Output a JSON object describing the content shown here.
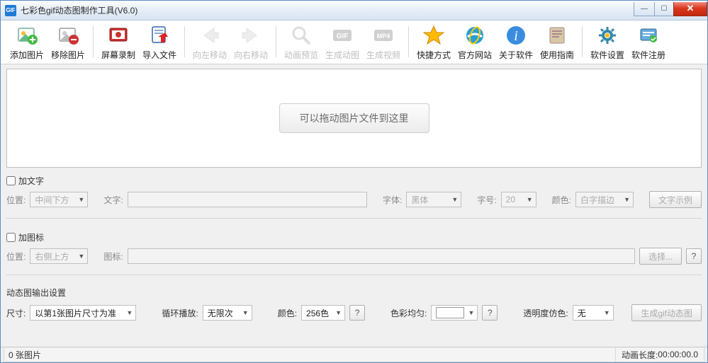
{
  "title": "七彩色gif动态图制作工具(V6.0)",
  "app_icon": "GIF",
  "toolbar": [
    {
      "id": "add-image",
      "label": "添加图片",
      "enabled": true,
      "icon": "add-image"
    },
    {
      "id": "remove-image",
      "label": "移除图片",
      "enabled": true,
      "icon": "remove-image"
    },
    {
      "sep": true
    },
    {
      "id": "screen-record",
      "label": "屏幕录制",
      "enabled": true,
      "icon": "record"
    },
    {
      "id": "import-file",
      "label": "导入文件",
      "enabled": true,
      "icon": "import"
    },
    {
      "sep": true
    },
    {
      "id": "move-left",
      "label": "向左移动",
      "enabled": false,
      "icon": "arrow-left"
    },
    {
      "id": "move-right",
      "label": "向右移动",
      "enabled": false,
      "icon": "arrow-right"
    },
    {
      "sep": true
    },
    {
      "id": "preview",
      "label": "动画预览",
      "enabled": false,
      "icon": "magnify"
    },
    {
      "id": "make-gif",
      "label": "生成动图",
      "enabled": false,
      "icon": "gif"
    },
    {
      "id": "make-video",
      "label": "生成视频",
      "enabled": false,
      "icon": "mp4"
    },
    {
      "sep": true
    },
    {
      "id": "shortcut",
      "label": "快捷方式",
      "enabled": true,
      "icon": "star"
    },
    {
      "id": "website",
      "label": "官方网站",
      "enabled": true,
      "icon": "ie"
    },
    {
      "id": "about",
      "label": "关于软件",
      "enabled": true,
      "icon": "info"
    },
    {
      "id": "guide",
      "label": "使用指南",
      "enabled": true,
      "icon": "book"
    },
    {
      "sep": true
    },
    {
      "id": "settings",
      "label": "软件设置",
      "enabled": true,
      "icon": "gear"
    },
    {
      "id": "register",
      "label": "软件注册",
      "enabled": true,
      "icon": "register"
    }
  ],
  "drop_hint": "可以拖动图片文件到这里",
  "text_panel": {
    "checkbox_label": "加文字",
    "pos_label": "位置:",
    "pos_value": "中间下方",
    "text_label": "文字:",
    "text_value": "",
    "font_label": "字体:",
    "font_value": "黑体",
    "size_label": "字号:",
    "size_value": "20",
    "color_label": "颜色:",
    "color_value": "白字描边",
    "sample_btn": "文字示例"
  },
  "icon_panel": {
    "checkbox_label": "加图标",
    "pos_label": "位置:",
    "pos_value": "右侧上方",
    "icon_label": "图标:",
    "icon_value": "",
    "select_btn": "选择...",
    "help": "?"
  },
  "output_panel": {
    "title": "动态图输出设置",
    "size_label": "尺寸:",
    "size_value": "以第1张图片尺寸为准",
    "loop_label": "循环播放:",
    "loop_value": "无限次",
    "color_label": "颜色:",
    "color_value": "256色",
    "color_help": "?",
    "avg_label": "色彩均匀:",
    "avg_value": "",
    "avg_help": "?",
    "dither_label": "透明度仿色:",
    "dither_value": "无",
    "make_btn": "生成gif动态图"
  },
  "status": {
    "left": "0 张图片",
    "right_label": "动画长度:",
    "right_value": "00:00:00.0"
  }
}
